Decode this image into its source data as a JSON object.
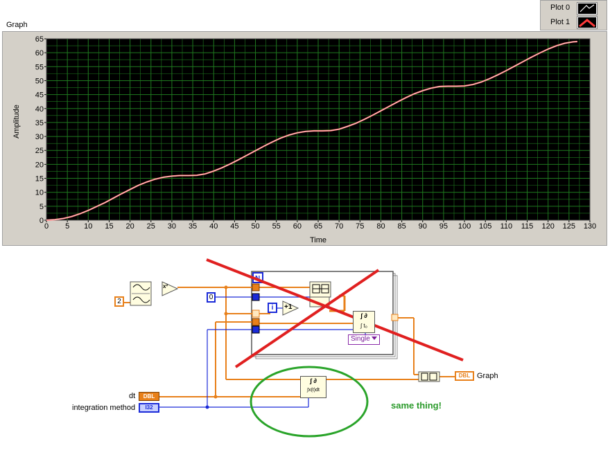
{
  "graph": {
    "title": "Graph",
    "ylabel": "Amplitude",
    "xlabel": "Time",
    "legend": [
      {
        "label": "Plot 0",
        "color": "#ffffff"
      },
      {
        "label": "Plot 1",
        "color": "#ff3b3b"
      }
    ],
    "plot_background": "#000000",
    "grid_color": "#1f7a1f",
    "curve_color": "#ff6e6e"
  },
  "chart_data": {
    "type": "line",
    "title": "Graph",
    "xlabel": "Time",
    "ylabel": "Amplitude",
    "xlim": [
      0,
      130
    ],
    "ylim": [
      0,
      65
    ],
    "xticks": [
      0,
      5,
      10,
      15,
      20,
      25,
      30,
      35,
      40,
      45,
      50,
      55,
      60,
      65,
      70,
      75,
      80,
      85,
      90,
      95,
      100,
      105,
      110,
      115,
      120,
      125,
      130
    ],
    "yticks": [
      0,
      5,
      10,
      15,
      20,
      25,
      30,
      35,
      40,
      45,
      50,
      55,
      60,
      65
    ],
    "grid": true,
    "legend_position": "top-right",
    "series": [
      {
        "name": "Plot 1",
        "color": "#ff6e6e",
        "x": [
          0,
          2,
          4,
          6,
          8,
          10,
          12,
          14,
          16,
          18,
          20,
          22,
          24,
          26,
          28,
          30,
          32,
          34,
          36,
          38,
          40,
          42,
          44,
          46,
          48,
          50,
          52,
          54,
          56,
          58,
          60,
          62,
          64,
          66,
          68,
          70,
          72,
          74,
          76,
          78,
          80,
          82,
          84,
          86,
          88,
          90,
          92,
          94,
          96,
          98,
          100,
          102,
          104,
          106,
          108,
          110,
          112,
          114,
          116,
          118,
          120,
          122,
          124,
          126,
          127
        ],
        "y": [
          0,
          0.2,
          0.6,
          1.3,
          2.3,
          3.5,
          4.9,
          6.3,
          7.9,
          9.5,
          11,
          12.5,
          13.7,
          14.7,
          15.4,
          15.8,
          16,
          16,
          16.1,
          16.6,
          17.6,
          18.8,
          20.2,
          21.7,
          23.3,
          24.9,
          26.5,
          28,
          29.4,
          30.5,
          31.3,
          31.8,
          32,
          32,
          32.1,
          32.6,
          33.6,
          34.7,
          36.1,
          37.6,
          39.2,
          40.8,
          42.4,
          43.9,
          45.3,
          46.4,
          47.3,
          47.9,
          48,
          48,
          48.1,
          48.6,
          49.5,
          50.7,
          52.1,
          53.6,
          55.2,
          56.8,
          58.4,
          59.9,
          61.3,
          62.5,
          63.4,
          63.9,
          64
        ]
      }
    ]
  },
  "diagram": {
    "const_2": "2",
    "const_0": "0",
    "index": "i",
    "square_fn": "x²",
    "increment": "+1",
    "integral_top": "∫ ∂",
    "integral_bottom": "∫ t₀",
    "single_dropdown": "Single",
    "integral_plain_top": "∫ ∂",
    "integral_plain_bottom": "∫x(t)dt",
    "dt_label": "dt",
    "dt_type": "DBL",
    "method_label": "integration method",
    "method_type": "I32",
    "graph_type": "DBL",
    "graph_label": "Graph",
    "note": "same thing!"
  }
}
